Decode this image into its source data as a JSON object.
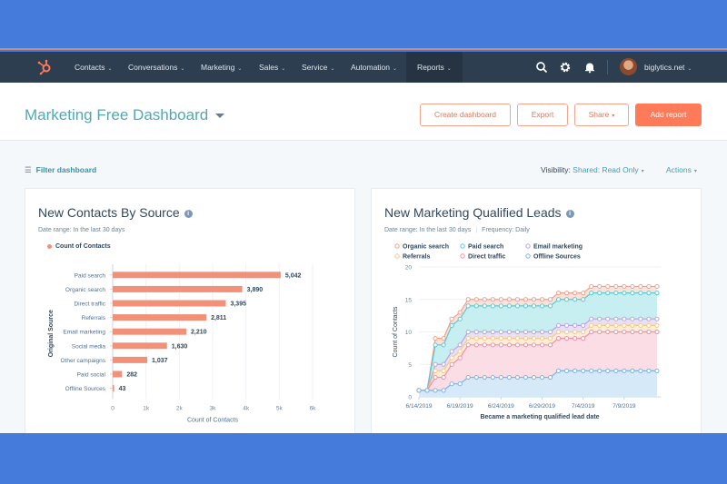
{
  "colors": {
    "brand_orange": "#ff7a59",
    "nav_bg": "#2d3e50",
    "title_teal": "#4fa9b4",
    "frame_blue": "#457cdc"
  },
  "nav": {
    "logo_icon": "hubspot-sprocket-icon",
    "items": [
      {
        "label": "Contacts"
      },
      {
        "label": "Conversations"
      },
      {
        "label": "Marketing"
      },
      {
        "label": "Sales"
      },
      {
        "label": "Service"
      },
      {
        "label": "Automation"
      },
      {
        "label": "Reports"
      }
    ],
    "icons": [
      "search-icon",
      "gear-icon",
      "bell-icon"
    ],
    "account": "biglytics.net"
  },
  "header": {
    "title": "Marketing Free Dashboard",
    "buttons": {
      "create_dashboard": "Create dashboard",
      "export": "Export",
      "share": "Share",
      "add_report": "Add report"
    }
  },
  "toolbar": {
    "filter": "Filter dashboard",
    "visibility_label": "Visibility:",
    "visibility_value": "Shared: Read Only",
    "actions": "Actions"
  },
  "cards": [
    {
      "title": "New Contacts By Source",
      "date_range": "Date range: In the last 30 days",
      "legend": "Count of Contacts"
    },
    {
      "title": "New Marketing Qualified Leads",
      "date_range": "Date range: In the last 30 days",
      "frequency": "Frequency: Daily"
    }
  ],
  "chart_data": [
    {
      "type": "bar",
      "orientation": "horizontal",
      "title": "New Contacts By Source",
      "categories": [
        "Paid search",
        "Organic search",
        "Direct traffic",
        "Referrals",
        "Email marketing",
        "Social media",
        "Other campaigns",
        "Paid social",
        "Offline Sources"
      ],
      "values": [
        5042,
        3890,
        3395,
        2811,
        2210,
        1630,
        1037,
        282,
        43
      ],
      "value_labels": [
        "5,042",
        "3,890",
        "3,395",
        "2,811",
        "2,210",
        "1,630",
        "1,037",
        "282",
        "43"
      ],
      "series_name": "Count of Contacts",
      "xlabel": "Count of Contacts",
      "ylabel": "Original Source",
      "xlim": [
        0,
        6000
      ],
      "xticks": [
        "0",
        "1k",
        "2k",
        "3k",
        "4k",
        "5k",
        "6k"
      ],
      "color": "#f2917a",
      "grid": true
    },
    {
      "type": "area",
      "stacked": false,
      "title": "New Marketing Qualified Leads",
      "xlabel": "Became a marketing qualified lead date",
      "ylabel": "Count of Contacts",
      "ylim": [
        0,
        20
      ],
      "yticks": [
        0,
        5,
        10,
        15,
        20
      ],
      "xtick_labels": [
        "6/14/2019",
        "6/19/2019",
        "6/24/2019",
        "6/29/2019",
        "7/4/2019",
        "7/9/2019"
      ],
      "x_days": 30,
      "legend_position": "top",
      "series": [
        {
          "name": "Organic search",
          "color": "#f2a08c",
          "values": [
            1,
            1,
            9,
            9,
            12,
            13,
            15,
            15,
            15,
            15,
            15,
            15,
            15,
            15,
            15,
            15,
            15,
            16,
            16,
            16,
            16,
            17,
            17,
            17,
            17,
            17,
            17,
            17,
            17,
            17
          ]
        },
        {
          "name": "Paid search",
          "color": "#5ec8cf",
          "values": [
            1,
            1,
            8,
            8,
            11,
            12,
            14,
            14,
            14,
            14,
            14,
            14,
            14,
            14,
            14,
            14,
            14,
            15,
            15,
            15,
            15,
            16,
            16,
            16,
            16,
            16,
            16,
            16,
            16,
            16
          ]
        },
        {
          "name": "Email marketing",
          "color": "#b9a4e0",
          "values": [
            1,
            1,
            5,
            5,
            7,
            8,
            10,
            10,
            10,
            10,
            10,
            10,
            10,
            10,
            10,
            10,
            10,
            11,
            11,
            11,
            11,
            12,
            12,
            12,
            12,
            12,
            12,
            12,
            12,
            12
          ]
        },
        {
          "name": "Referrals",
          "color": "#f5c98a",
          "values": [
            1,
            1,
            4,
            4,
            6,
            7,
            9,
            9,
            9,
            9,
            9,
            9,
            9,
            9,
            9,
            9,
            9,
            10,
            10,
            10,
            10,
            11,
            11,
            11,
            11,
            11,
            11,
            11,
            11,
            11
          ]
        },
        {
          "name": "Direct traffic",
          "color": "#ee8fa8",
          "values": [
            1,
            1,
            3,
            3,
            5,
            6,
            8,
            8,
            8,
            8,
            8,
            8,
            8,
            8,
            8,
            8,
            8,
            9,
            9,
            9,
            9,
            10,
            10,
            10,
            10,
            10,
            10,
            10,
            10,
            10
          ]
        },
        {
          "name": "Offline Sources",
          "color": "#7fb3e0",
          "values": [
            1,
            1,
            1,
            1,
            2,
            2,
            3,
            3,
            3,
            3,
            3,
            3,
            3,
            3,
            3,
            3,
            3,
            4,
            4,
            4,
            4,
            4,
            4,
            4,
            4,
            4,
            4,
            4,
            4,
            4
          ]
        }
      ],
      "grid": true
    }
  ]
}
